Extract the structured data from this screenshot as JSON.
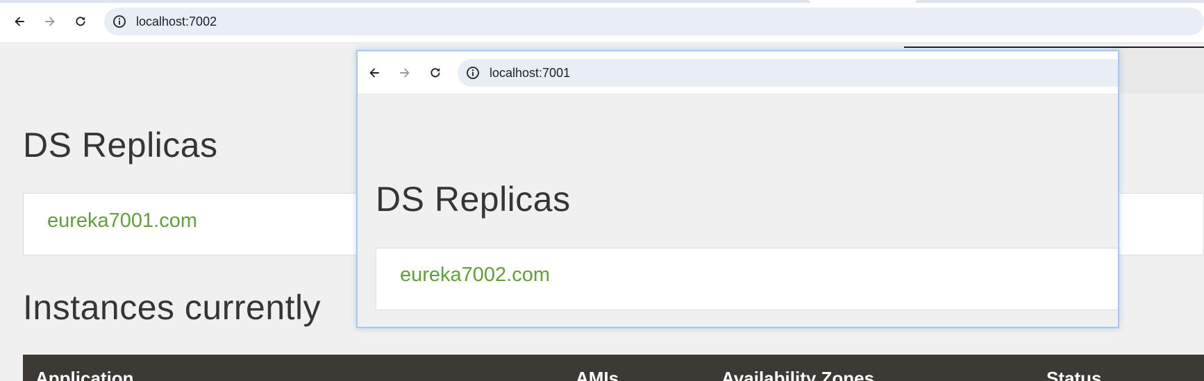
{
  "back_window": {
    "url": "localhost:7002",
    "heading_replicas": "DS Replicas",
    "replica_link": "eureka7001.com",
    "heading_instances": "Instances currently",
    "table_columns": [
      "Application",
      "AMIs",
      "Availability Zones",
      "Status"
    ]
  },
  "front_window": {
    "url": "localhost:7001",
    "heading_replicas": "DS Replicas",
    "replica_link": "eureka7002.com"
  },
  "icons": {
    "back": "arrow-left-icon",
    "forward": "arrow-right-icon",
    "reload": "reload-icon",
    "site_info": "info-circle-icon"
  },
  "colors": {
    "link": "#5fa134",
    "table_header": "#3d3934",
    "page_bg": "#f0f0f0",
    "omnibox": "#e9edf6",
    "popup_border": "#a7c8ee"
  }
}
